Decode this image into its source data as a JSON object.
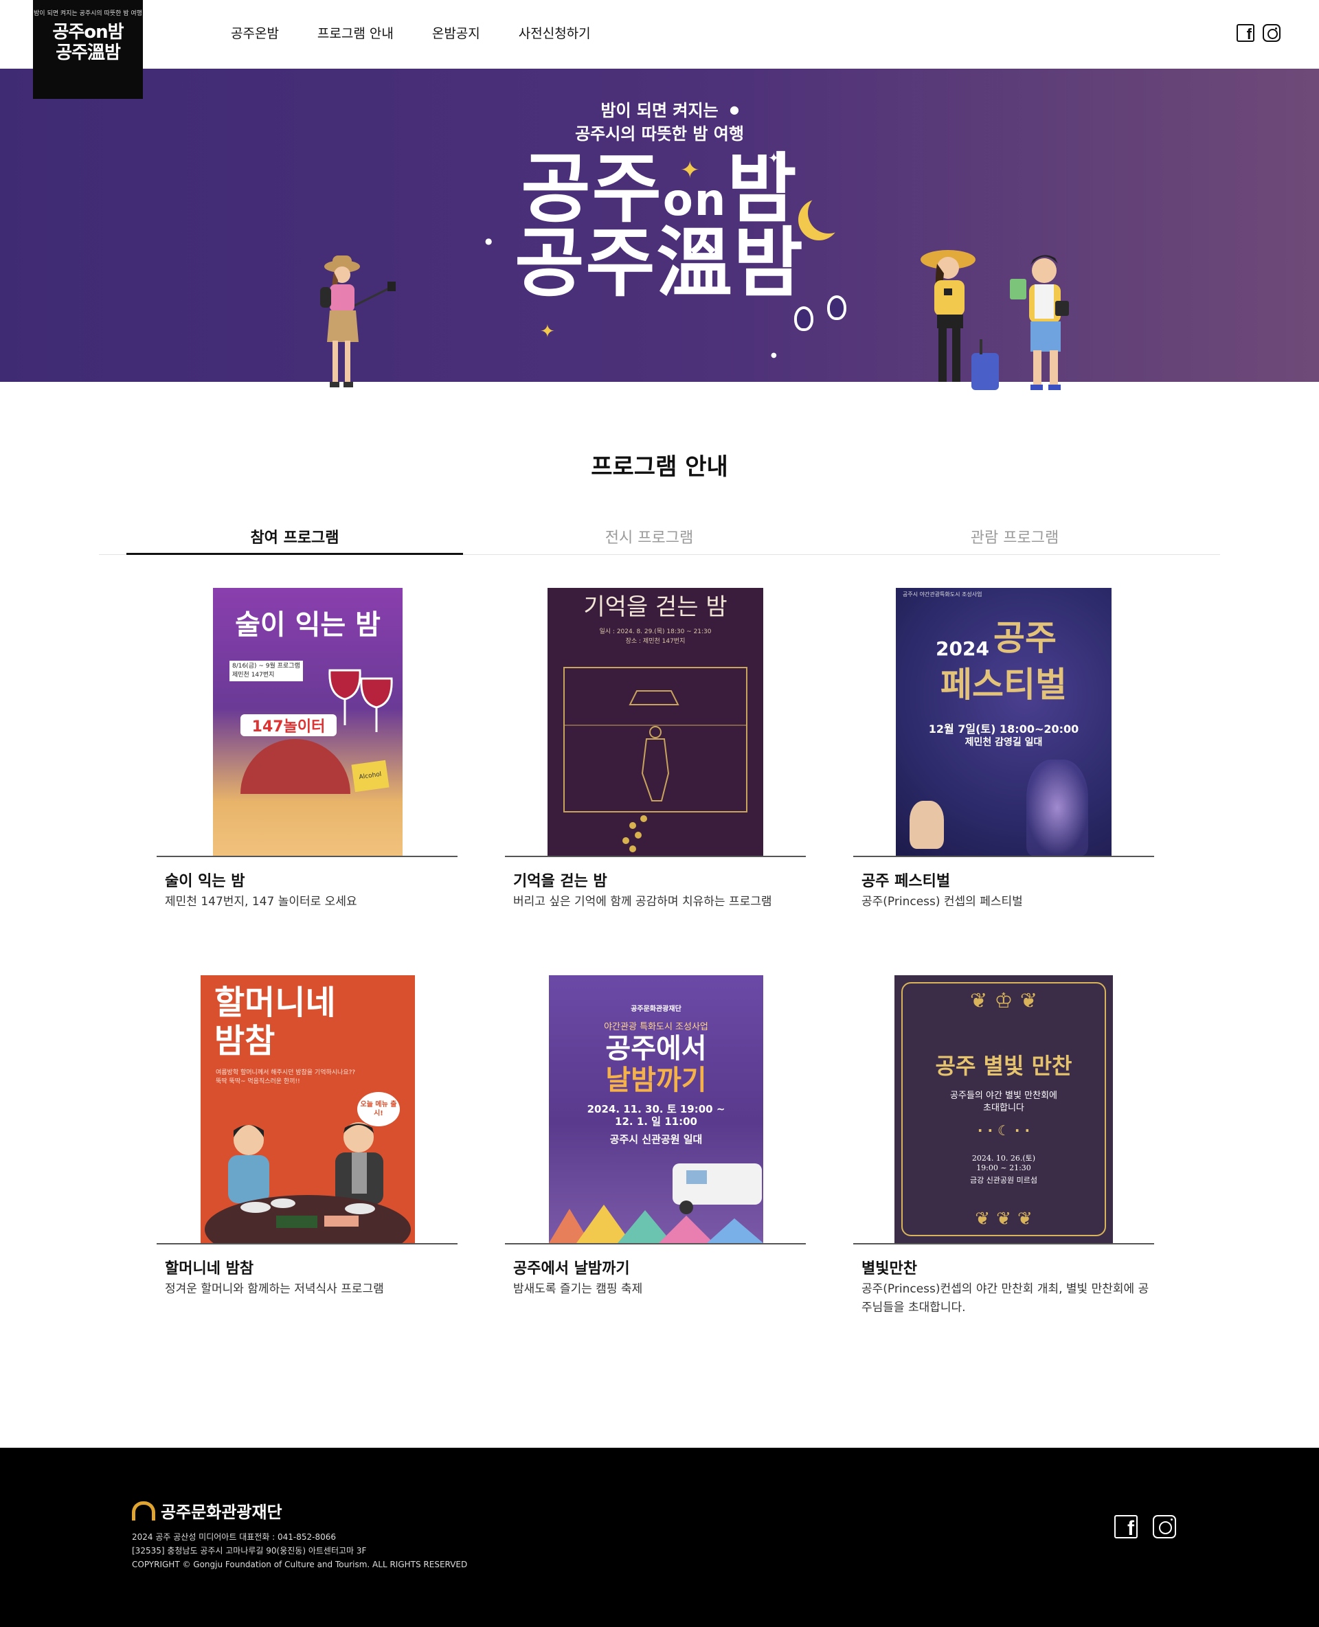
{
  "header": {
    "logo": {
      "tagline": "밤이 되면 켜지는 공주시의 따뜻한 밤 여행",
      "line1": "공주on밤",
      "line2": "공주溫밤"
    },
    "nav": [
      "공주온밤",
      "프로그램 안내",
      "온밤공지",
      "사전신청하기"
    ],
    "social": [
      "facebook-icon",
      "instagram-icon"
    ]
  },
  "hero": {
    "subtitle_line1": "밤이 되면 켜지는",
    "subtitle_line2": "공주시의 따뜻한 밤 여행",
    "title_line1_a": "공주",
    "title_line1_b": "on",
    "title_line1_c": "밤",
    "title_line2": "공주溫밤"
  },
  "section": {
    "title": "프로그램 안내",
    "tabs": [
      {
        "label": "참여 프로그램",
        "active": true
      },
      {
        "label": "전시 프로그램",
        "active": false
      },
      {
        "label": "관람 프로그램",
        "active": false
      }
    ]
  },
  "programs": [
    {
      "title": "술이 익는 밤",
      "desc": "제민천 147번지, 147 놀이터로 오세요",
      "poster": {
        "headline": "술이 익는 밤",
        "sub1": "8/16(금) ~ 9월 프로그램",
        "sub2": "제민천 147번지",
        "banner": "147놀이터",
        "tag": "Alcohol",
        "bg": "#7a3f9a"
      }
    },
    {
      "title": "기억을 걷는 밤",
      "desc": "버리고 싶은 기억에 함께 공감하며 치유하는 프로그램",
      "poster": {
        "headline": "기억을 걷는 밤",
        "sub1": "일시 : 2024. 8. 29.(목) 18:30 ~ 21:30",
        "sub2": "장소 : 제민천 147번지",
        "bg": "#3a1d3c"
      }
    },
    {
      "title": "공주 페스티벌",
      "desc": "공주(Princess) 컨셉의 페스티벌",
      "poster": {
        "top": "공주시 야간관광특화도시 조성사업",
        "year": "2024",
        "headline1": "공주",
        "headline2": "페스티벌",
        "date": "12월 7일(토) 18:00~20:00",
        "place": "제민천 감영길 일대",
        "bg": "#2c2a6a"
      }
    },
    {
      "title": "할머니네 밤참",
      "desc": "정겨운 할머니와 함께하는 저녁식사 프로그램",
      "poster": {
        "headline1": "할머니네",
        "headline2": "밤참",
        "sub1": "여름방학 할머니께서 해주시던 밤참을 기억하시나요??",
        "sub2": "뚝딱 뚝딱~ 먹음직스러운 한끼!!",
        "bubble": "오늘 메뉴 출시!",
        "bg": "#d9502f"
      }
    },
    {
      "title": "공주에서 날밤까기",
      "desc": "밤새도록 즐기는 캠핑 축제",
      "poster": {
        "top": "공주문화관광재단",
        "sub0": "야간관광 특화도시 조성사업",
        "headline1": "공주에서",
        "headline2": "날밤까기",
        "date1": "2024. 11. 30. 토 19:00 ~",
        "date2": "12. 1. 일 11:00",
        "place": "공주시 신관공원 일대",
        "bg": "#5a3a8c"
      }
    },
    {
      "title": "별빛만찬",
      "desc": "공주(Princess)컨셉의 야간 만찬회 개최, 별빛 만찬회에 공주님들을 초대합니다.",
      "poster": {
        "headline": "공주 별빛 만찬",
        "sub1": "공주들의 야간 별빛 만찬회에",
        "sub2": "초대합니다",
        "date": "2024. 10. 26.(토)",
        "time": "19:00 ~ 21:30",
        "place": "금강 신관공원 미르섬",
        "bg": "#3b2d48"
      }
    }
  ],
  "footer": {
    "org": "공주문화관광재단",
    "line1": "2024 공주 공산성 미디어아트 대표전화 : 041-852-8066",
    "line2": "[32535] 충청남도 공주시 고마나루길 90(웅진동) 아트센터고마 3F",
    "line3": "COPYRIGHT © Gongju Foundation of Culture and Tourism. ALL RIGHTS RESERVED"
  },
  "colors": {
    "hero_left": "#3f2b74",
    "hero_right": "#6e4a78",
    "accent_gold": "#f2c94c",
    "footer_bg": "#000000"
  }
}
